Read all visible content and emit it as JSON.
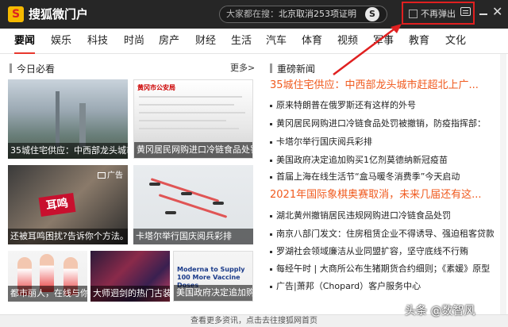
{
  "titlebar": {
    "app_title": "搜狐微门户",
    "search_prefix": "大家都在搜：",
    "search_query": "北京取消253项证明",
    "no_popup_label": "不再弹出"
  },
  "nav": {
    "items": [
      "要闻",
      "娱乐",
      "科技",
      "时尚",
      "房产",
      "财经",
      "生活",
      "汽车",
      "体育",
      "视频",
      "军事",
      "教育",
      "文化"
    ]
  },
  "left_section": {
    "title": "今日必看",
    "more_label": "更多>",
    "tiles": [
      {
        "caption": "35城住宅供应：中西部龙头城市"
      },
      {
        "caption": "黄冈居民网购进口冷链食品处罚",
        "doc_header": "黄冈市公安局"
      },
      {
        "caption": "还被耳鸣困扰?告诉你个方法。",
        "ad_label": "广告",
        "overlay_text": "耳鸣"
      },
      {
        "caption": "卡塔尔举行国庆阅兵彩排"
      },
      {
        "caption": "都市丽人，在线与你"
      },
      {
        "caption": "大师迥剑的热门古装"
      },
      {
        "caption": "美国政府决定追加购",
        "overlay_text": "Moderna to Supply 100 More Vaccine Doses"
      }
    ]
  },
  "right_section": {
    "title": "重磅新闻",
    "headlines": [
      {
        "text": "35城住宅供应：中西部龙头城市赶超北上广...",
        "highlight": true
      },
      {
        "text": "原来特朗普在俄罗斯还有这样的外号",
        "highlight": false
      },
      {
        "text": "黄冈居民网购进口冷链食品处罚被撤销，防疫指挥部：",
        "highlight": false
      },
      {
        "text": "卡塔尔举行国庆阅兵彩排",
        "highlight": false
      },
      {
        "text": "美国政府决定追加购买1亿剂莫德纳新冠疫苗",
        "highlight": false
      },
      {
        "text": "首届上海在线生活节“盒马暖冬消费季”今天启动",
        "highlight": false
      },
      {
        "text": "2021年国际象棋奥赛取消，未来几届还有这...",
        "highlight": true
      },
      {
        "text": "湖北黄州撤销居民违规网购进口冷链食品处罚",
        "highlight": false
      },
      {
        "text": "南京八部门发文：住房租赁企业不得诱导、强迫租客贷款",
        "highlight": false
      },
      {
        "text": "罗湖社会领域廉洁从业同盟扩容，坚守底线不行贿",
        "highlight": false
      },
      {
        "text": "每经午时 | 大商所公布生猪期货合约细则；《素媛》原型",
        "highlight": false
      },
      {
        "text": "广告|萧邦（Chopard）客户服务中心",
        "highlight": false
      }
    ]
  },
  "footer": {
    "text": "查看更多资讯，点击去往搜狐网首页"
  },
  "watermark": "头条 @数智风",
  "colors": {
    "titlebar_bg": "#262626",
    "nav_active_underline": "#e8382e",
    "headline_highlight": "#f05a1e",
    "annotation_red": "#e02020"
  },
  "icons": [
    "sohu-logo-icon",
    "search-icon",
    "checkbox-icon",
    "message-icon",
    "minimize-icon",
    "close-icon"
  ]
}
